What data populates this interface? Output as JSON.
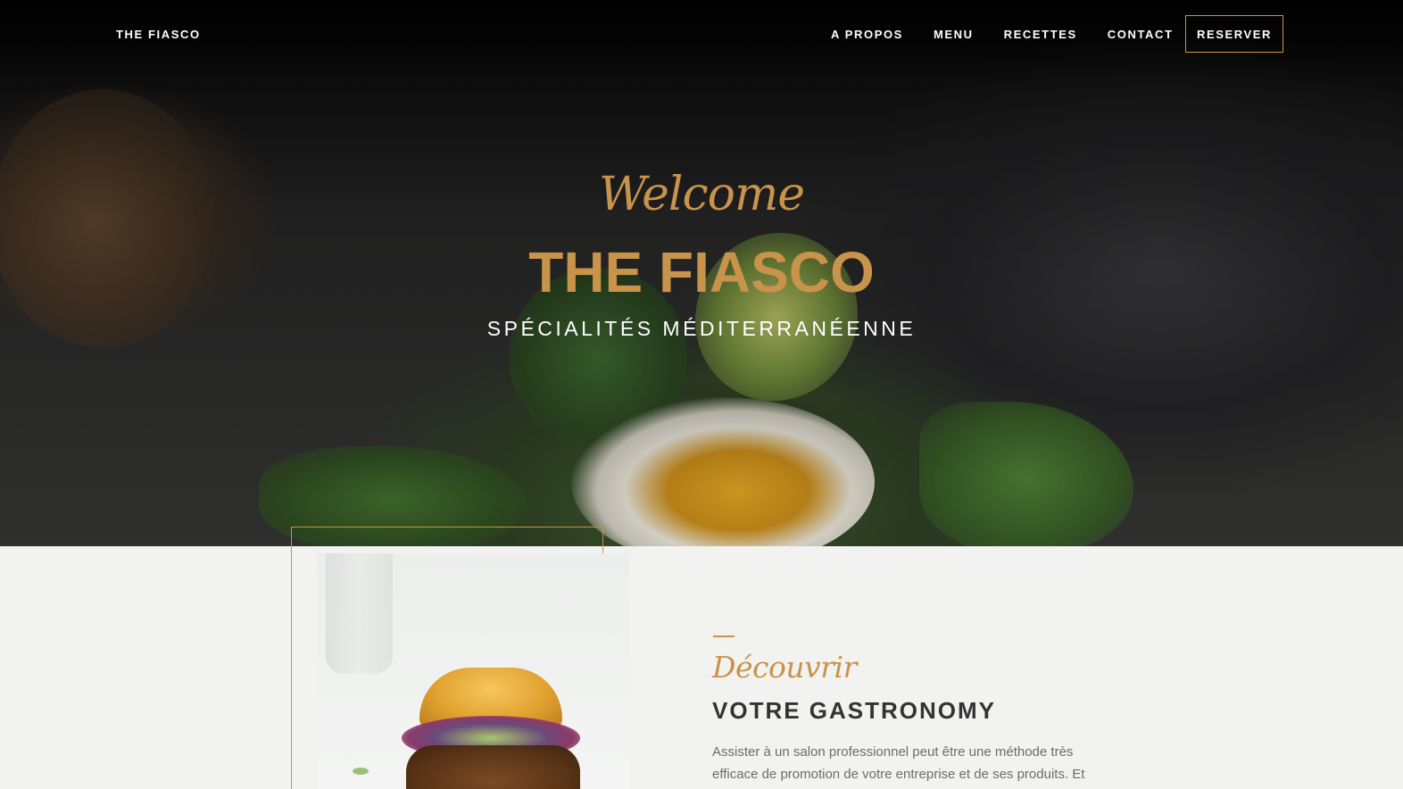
{
  "nav": {
    "brand": "THE FIASCO",
    "links": [
      "A PROPOS",
      "MENU",
      "RECETTES",
      "CONTACT"
    ],
    "reserve_label": "RESERVER"
  },
  "hero": {
    "welcome": "Welcome",
    "title": "THE FIASCO",
    "subtitle": "SPÉCIALITÉS MÉDITERRANÉENNE"
  },
  "about": {
    "script_heading": "Découvrir",
    "heading": "VOTRE GASTRONOMY",
    "paragraph": "Assister à un salon professionnel peut être une méthode très efficace de promotion de votre entreprise et de ses produits. Et"
  },
  "colors": {
    "accent": "#c8934a",
    "hero_dark": "#1a1a1a",
    "section_bg": "#f2f2f1",
    "heading_text": "#333333",
    "body_text": "#6c6c6c"
  }
}
